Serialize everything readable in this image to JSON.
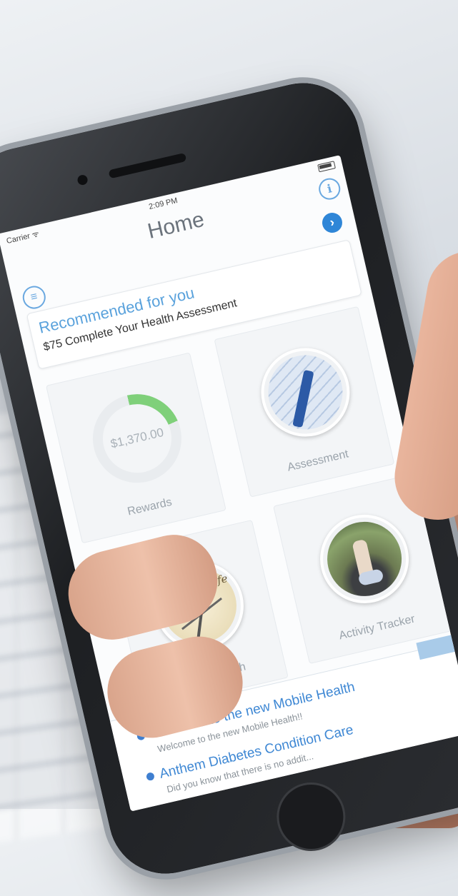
{
  "status_bar": {
    "carrier": "Carrier ᯤ",
    "time": "2:09 PM"
  },
  "header": {
    "title": "Home",
    "info_icon": "info-icon",
    "menu_icon": "menu-icon",
    "next_icon": "chevron-right-icon"
  },
  "recommended": {
    "title": "Recommended for you",
    "subtitle": "$75 Complete Your Health Assessment"
  },
  "tiles": {
    "rewards": {
      "label": "Rewards",
      "amount": "$1,370.00",
      "progress_fraction": 0.22
    },
    "assessment": {
      "label": "Assessment"
    },
    "health_coach": {
      "label": "Health Coach",
      "compass_text": "Healthy Life"
    },
    "activity_tracker": {
      "label": "Activity Tracker"
    }
  },
  "news": [
    {
      "title": "Welcome to the new Mobile Health",
      "snippet": "Welcome to the new Mobile Health!!"
    },
    {
      "title": "Anthem Diabetes Condition Care",
      "snippet": "Did you know that there is no addit..."
    }
  ],
  "colors": {
    "accent": "#3f88d4",
    "progress": "#7fd07a",
    "next_button": "#2f86d7"
  }
}
